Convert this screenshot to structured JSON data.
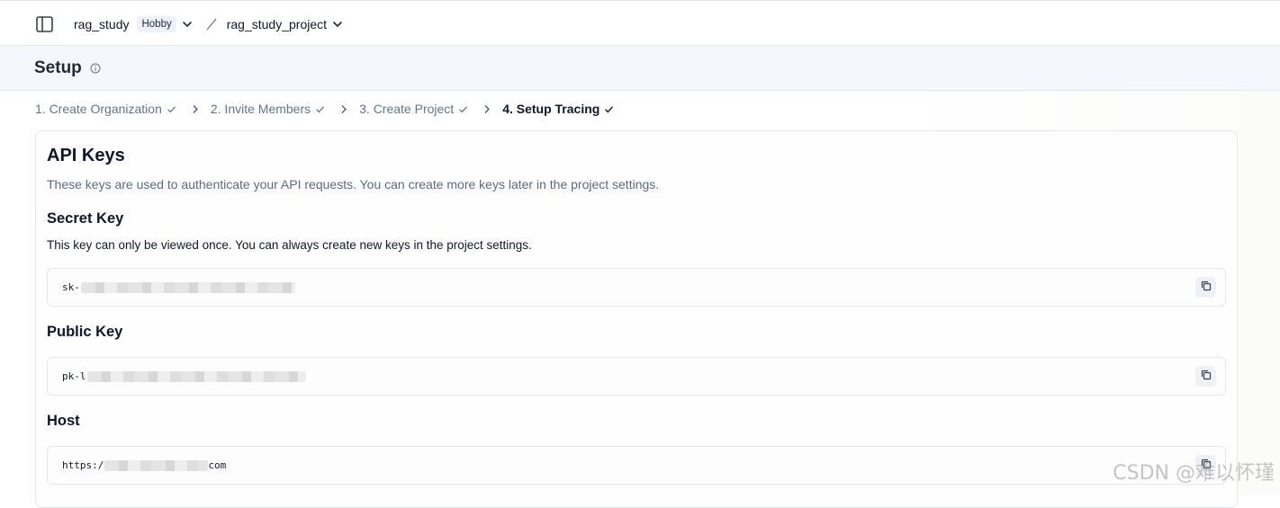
{
  "topbar": {
    "org_name": "rag_study",
    "plan_badge": "Hobby",
    "project_name": "rag_study_project"
  },
  "page": {
    "title": "Setup"
  },
  "steps": [
    {
      "label": "1. Create Organization",
      "state": "done"
    },
    {
      "label": "2. Invite Members",
      "state": "done"
    },
    {
      "label": "3. Create Project",
      "state": "done"
    },
    {
      "label": "4. Setup Tracing",
      "state": "active"
    }
  ],
  "api_keys": {
    "title": "API Keys",
    "description": "These keys are used to authenticate your API requests. You can create more keys later in the project settings.",
    "secret": {
      "title": "Secret Key",
      "description": "This key can only be viewed once. You can always create new keys in the project settings.",
      "value_prefix": "sk-"
    },
    "public": {
      "title": "Public Key",
      "value_prefix": "pk-l"
    },
    "host": {
      "title": "Host",
      "value_prefix": "https:/",
      "value_suffix": "com"
    }
  },
  "watermark": "CSDN @难以怀瑾",
  "icons": [
    "sidebar-toggle-icon",
    "chevron-down-icon",
    "slash-icon",
    "info-icon",
    "check-icon",
    "chevron-right-icon",
    "copy-icon"
  ]
}
